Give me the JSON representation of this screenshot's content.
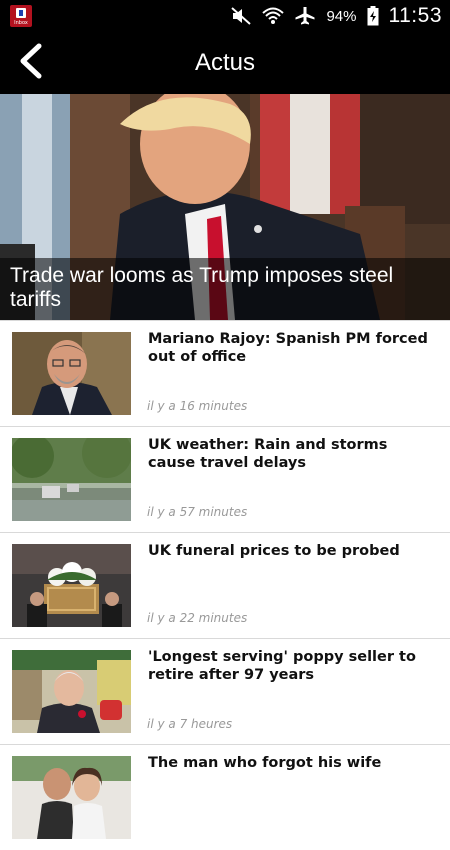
{
  "status_bar": {
    "battery": "94%",
    "time": "11:53",
    "app_notification_label": "Inbox",
    "icons": [
      "app-notification-icon",
      "mute-icon",
      "wifi-icon",
      "airplane-mode-icon",
      "battery-charging-icon"
    ]
  },
  "app_bar": {
    "title": "Actus",
    "back_icon": "back-arrow-icon"
  },
  "hero": {
    "headline": "Trade war looms as Trump imposes steel tariffs"
  },
  "articles": [
    {
      "title": "Mariano Rajoy: Spanish PM forced out of office",
      "time": "il y a 16 minutes"
    },
    {
      "title": "UK weather: Rain and storms cause travel delays",
      "time": "il y a 57 minutes"
    },
    {
      "title": "UK funeral prices to be probed",
      "time": "il y a 22 minutes"
    },
    {
      "title": "'Longest serving' poppy seller to retire after 97 years",
      "time": "il y a 7 heures"
    },
    {
      "title": "The man who forgot his wife",
      "time": ""
    }
  ]
}
